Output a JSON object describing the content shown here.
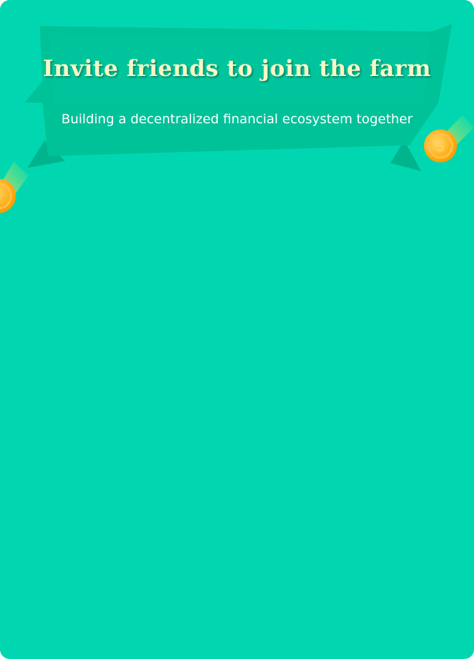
{
  "banner": {
    "title": "Invite friends to join the farm",
    "subtitle": "Building a decentralized financial ecosystem together"
  },
  "decorations": {
    "coin_icon": "gold-coin-icon"
  },
  "colors": {
    "background": "#00d7b0",
    "ribbon": "#00c197",
    "ribbon_fold": "#00a985",
    "title_text": "#f6f7c4",
    "subtitle_text": "#ffffff",
    "coin": "#ffb300"
  }
}
